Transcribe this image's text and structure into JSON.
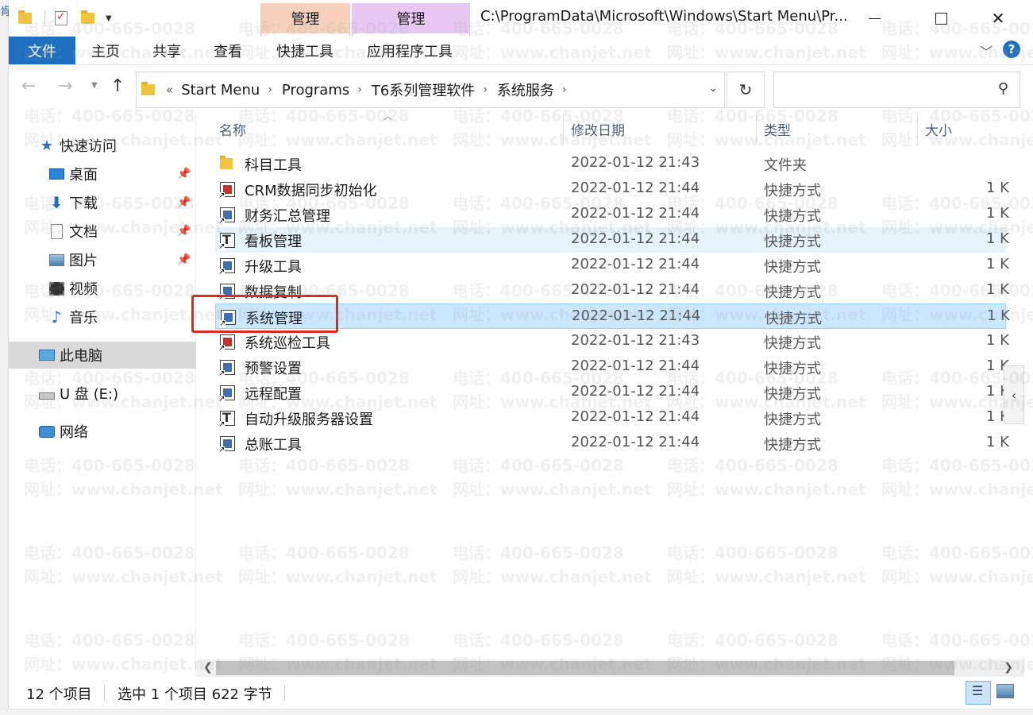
{
  "window": {
    "title_path": "C:\\ProgramData\\Microsoft\\Windows\\Start Menu\\Pr...",
    "edge_char": "肯"
  },
  "context_tabs": {
    "group1": "管理",
    "group2": "管理"
  },
  "ribbon": {
    "file": "文件",
    "home": "主页",
    "share": "共享",
    "view": "查看",
    "shortcut_tools": "快捷工具",
    "app_tools": "应用程序工具",
    "help": "?"
  },
  "address": {
    "lead": "«",
    "crumbs": [
      "Start Menu",
      "Programs",
      "T6系列管理软件",
      "系统服务"
    ],
    "search_placeholder": ""
  },
  "nav_pane": {
    "quick_access": "快速访问",
    "items": [
      {
        "label": "桌面",
        "icon": "desktop-icon",
        "pinned": true
      },
      {
        "label": "下载",
        "icon": "download-icon",
        "pinned": true
      },
      {
        "label": "文档",
        "icon": "document-icon",
        "pinned": true
      },
      {
        "label": "图片",
        "icon": "pictures-icon",
        "pinned": true
      },
      {
        "label": "视频",
        "icon": "video-icon",
        "pinned": false
      },
      {
        "label": "音乐",
        "icon": "music-icon",
        "pinned": false
      }
    ],
    "this_pc": "此电脑",
    "usb": "U 盘 (E:)",
    "network": "网络"
  },
  "columns": {
    "name": "名称",
    "date": "修改日期",
    "type": "类型",
    "size": "大小"
  },
  "files": [
    {
      "name": "科目工具",
      "date": "2022-01-12 21:43",
      "type": "文件夹",
      "size": "",
      "icon": "folder-icon"
    },
    {
      "name": "CRM数据同步初始化",
      "date": "2022-01-12 21:44",
      "type": "快捷方式",
      "size": "1 K",
      "icon": "crm-shortcut-icon"
    },
    {
      "name": "财务汇总管理",
      "date": "2022-01-12 21:44",
      "type": "快捷方式",
      "size": "1 K",
      "icon": "shortcut-icon"
    },
    {
      "name": "看板管理",
      "date": "2022-01-12 21:44",
      "type": "快捷方式",
      "size": "1 K",
      "icon": "t6-shortcut-icon"
    },
    {
      "name": "升级工具",
      "date": "2022-01-12 21:44",
      "type": "快捷方式",
      "size": "1 K",
      "icon": "shortcut-icon"
    },
    {
      "name": "数据复制",
      "date": "2022-01-12 21:44",
      "type": "快捷方式",
      "size": "1 K",
      "icon": "shortcut-icon"
    },
    {
      "name": "系统管理",
      "date": "2022-01-12 21:44",
      "type": "快捷方式",
      "size": "1 K",
      "icon": "shortcut-icon"
    },
    {
      "name": "系统巡检工具",
      "date": "2022-01-12 21:43",
      "type": "快捷方式",
      "size": "1 K",
      "icon": "red-shortcut-icon"
    },
    {
      "name": "预警设置",
      "date": "2022-01-12 21:44",
      "type": "快捷方式",
      "size": "1 K",
      "icon": "shortcut-icon"
    },
    {
      "name": "远程配置",
      "date": "2022-01-12 21:44",
      "type": "快捷方式",
      "size": "1 K",
      "icon": "shortcut-icon"
    },
    {
      "name": "自动升级服务器设置",
      "date": "2022-01-12 21:44",
      "type": "快捷方式",
      "size": "1 K",
      "icon": "t6-shortcut-icon"
    },
    {
      "name": "总账工具",
      "date": "2022-01-12 21:44",
      "type": "快捷方式",
      "size": "1 K",
      "icon": "shortcut-icon"
    }
  ],
  "status": {
    "count": "12 个项目",
    "selection": "选中 1 个项目  622 字节"
  },
  "watermark": {
    "phone": "电话：400-665-0028",
    "site": "网址：www.chanjet.net"
  },
  "colors": {
    "accent": "#1f6fc1",
    "selected_row": "#cce8ff",
    "hover_row": "#e5f3fb",
    "highlight_box": "#e0291e"
  }
}
